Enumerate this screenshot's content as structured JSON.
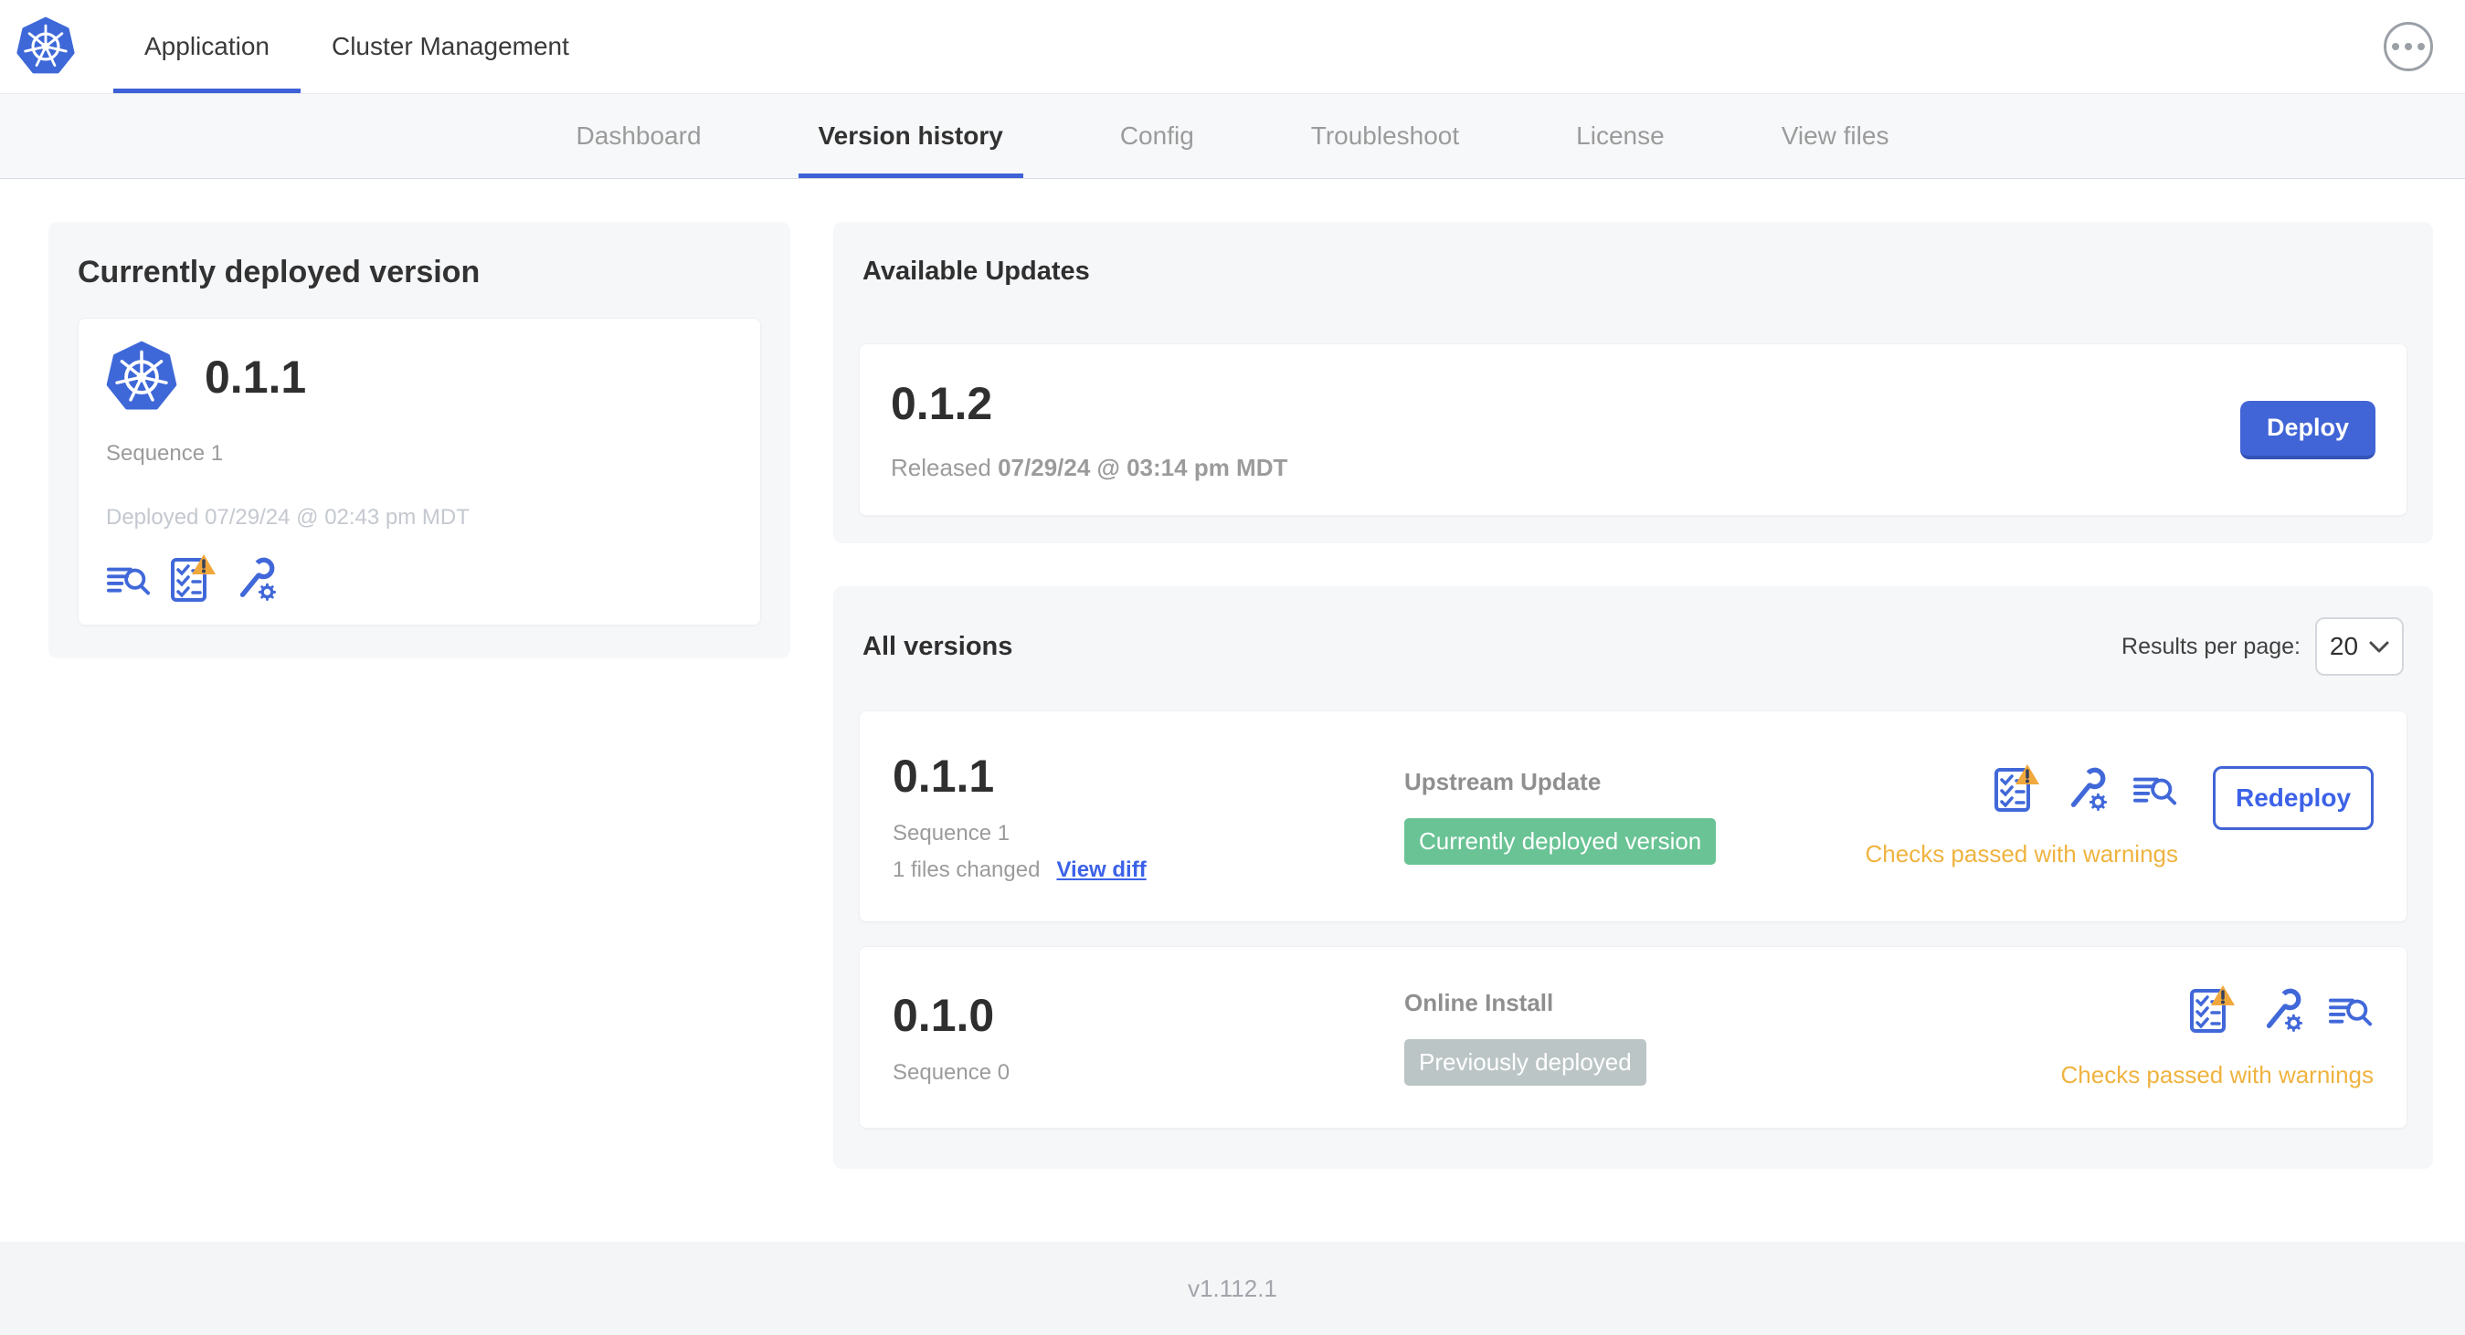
{
  "header": {
    "tabs": [
      {
        "label": "Application",
        "active": true
      },
      {
        "label": "Cluster Management",
        "active": false
      }
    ]
  },
  "subnav": {
    "tabs": [
      {
        "label": "Dashboard",
        "active": false
      },
      {
        "label": "Version history",
        "active": true
      },
      {
        "label": "Config",
        "active": false
      },
      {
        "label": "Troubleshoot",
        "active": false
      },
      {
        "label": "License",
        "active": false
      },
      {
        "label": "View files",
        "active": false
      }
    ]
  },
  "current_version": {
    "title": "Currently deployed version",
    "version": "0.1.1",
    "sequence": "Sequence 1",
    "deployed": "Deployed 07/29/24 @ 02:43 pm MDT",
    "icons": [
      "diff-icon",
      "preflight-checks-warning-icon",
      "config-icon"
    ]
  },
  "available_updates": {
    "title": "Available Updates",
    "version": "0.1.2",
    "released_prefix": "Released",
    "released_date": "07/29/24 @ 03:14 pm MDT",
    "deploy_label": "Deploy"
  },
  "all_versions": {
    "title": "All versions",
    "results_per_page_label": "Results per page:",
    "results_per_page_value": "20",
    "rows": [
      {
        "version": "0.1.1",
        "sequence": "Sequence 1",
        "files_changed": "1 files changed",
        "view_diff_label": "View diff",
        "source": "Upstream Update",
        "badge": "Currently deployed version",
        "badge_type": "green",
        "checks": "Checks passed with warnings",
        "action_label": "Redeploy"
      },
      {
        "version": "0.1.0",
        "sequence": "Sequence 0",
        "source": "Online Install",
        "badge": "Previously deployed",
        "badge_type": "gray",
        "checks": "Checks passed with warnings"
      }
    ]
  },
  "footer": {
    "app_version": "v1.112.1"
  },
  "colors": {
    "accent_blue": "#3e61d8",
    "deploy_button": "#4164d6",
    "badge_green": "#69c394",
    "badge_gray": "#bcc5c6",
    "warning_amber": "#efb340",
    "warning_triangle": "#f0a83c",
    "text_gray": "#9b9b9b",
    "text_light_gray": "#c4c8cf",
    "card_bg": "#f6f7f9"
  }
}
